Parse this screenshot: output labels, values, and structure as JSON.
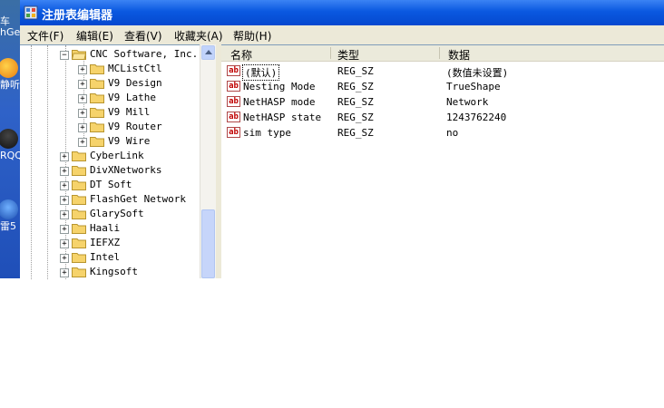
{
  "desktop": {
    "icons": [
      {
        "label": "车\nhGe.",
        "name": "desktop-icon-car"
      },
      {
        "label": "静听",
        "name": "desktop-icon-music"
      },
      {
        "label": "RQQ",
        "name": "desktop-icon-qq"
      },
      {
        "label": "雷5",
        "name": "desktop-icon-thunder"
      }
    ]
  },
  "window": {
    "title": "注册表编辑器",
    "icon": "regedit-icon"
  },
  "menu": [
    {
      "label": "文件(F)"
    },
    {
      "label": "编辑(E)"
    },
    {
      "label": "查看(V)"
    },
    {
      "label": "收藏夹(A)"
    },
    {
      "label": "帮助(H)"
    }
  ],
  "tree": {
    "nodes": [
      {
        "label": "CNC Software, Inc.",
        "expanded": true,
        "level": 2
      },
      {
        "label": "MCListCtl",
        "expanded": false,
        "level": 3
      },
      {
        "label": "V9 Design",
        "expanded": false,
        "level": 3
      },
      {
        "label": "V9 Lathe",
        "expanded": false,
        "level": 3
      },
      {
        "label": "V9 Mill",
        "expanded": false,
        "level": 3
      },
      {
        "label": "V9 Router",
        "expanded": false,
        "level": 3
      },
      {
        "label": "V9 Wire",
        "expanded": false,
        "level": 3
      },
      {
        "label": "CyberLink",
        "expanded": false,
        "level": 1
      },
      {
        "label": "DivXNetworks",
        "expanded": false,
        "level": 1
      },
      {
        "label": "DT Soft",
        "expanded": false,
        "level": 1
      },
      {
        "label": "FlashGet Network",
        "expanded": false,
        "level": 1
      },
      {
        "label": "GlarySoft",
        "expanded": false,
        "level": 1
      },
      {
        "label": "Haali",
        "expanded": false,
        "level": 1
      },
      {
        "label": "IEFXZ",
        "expanded": false,
        "level": 1
      },
      {
        "label": "Intel",
        "expanded": false,
        "level": 1
      },
      {
        "label": "Kingsoft",
        "expanded": false,
        "level": 1
      }
    ]
  },
  "list": {
    "columns": {
      "name": "名称",
      "type": "类型",
      "data": "数据"
    },
    "rows": [
      {
        "name": "(默认)",
        "type": "REG_SZ",
        "data": "(数值未设置)"
      },
      {
        "name": "Nesting Mode",
        "type": "REG_SZ",
        "data": "TrueShape"
      },
      {
        "name": "NetHASP mode",
        "type": "REG_SZ",
        "data": "Network"
      },
      {
        "name": "NetHASP state",
        "type": "REG_SZ",
        "data": "1243762240"
      },
      {
        "name": "sim type",
        "type": "REG_SZ",
        "data": "no"
      }
    ]
  },
  "colors": {
    "titlebar": "#0a58e0",
    "window_bg": "#ece9d8",
    "folder": "#f6d36b",
    "reg_sz_icon": "#c00000"
  }
}
